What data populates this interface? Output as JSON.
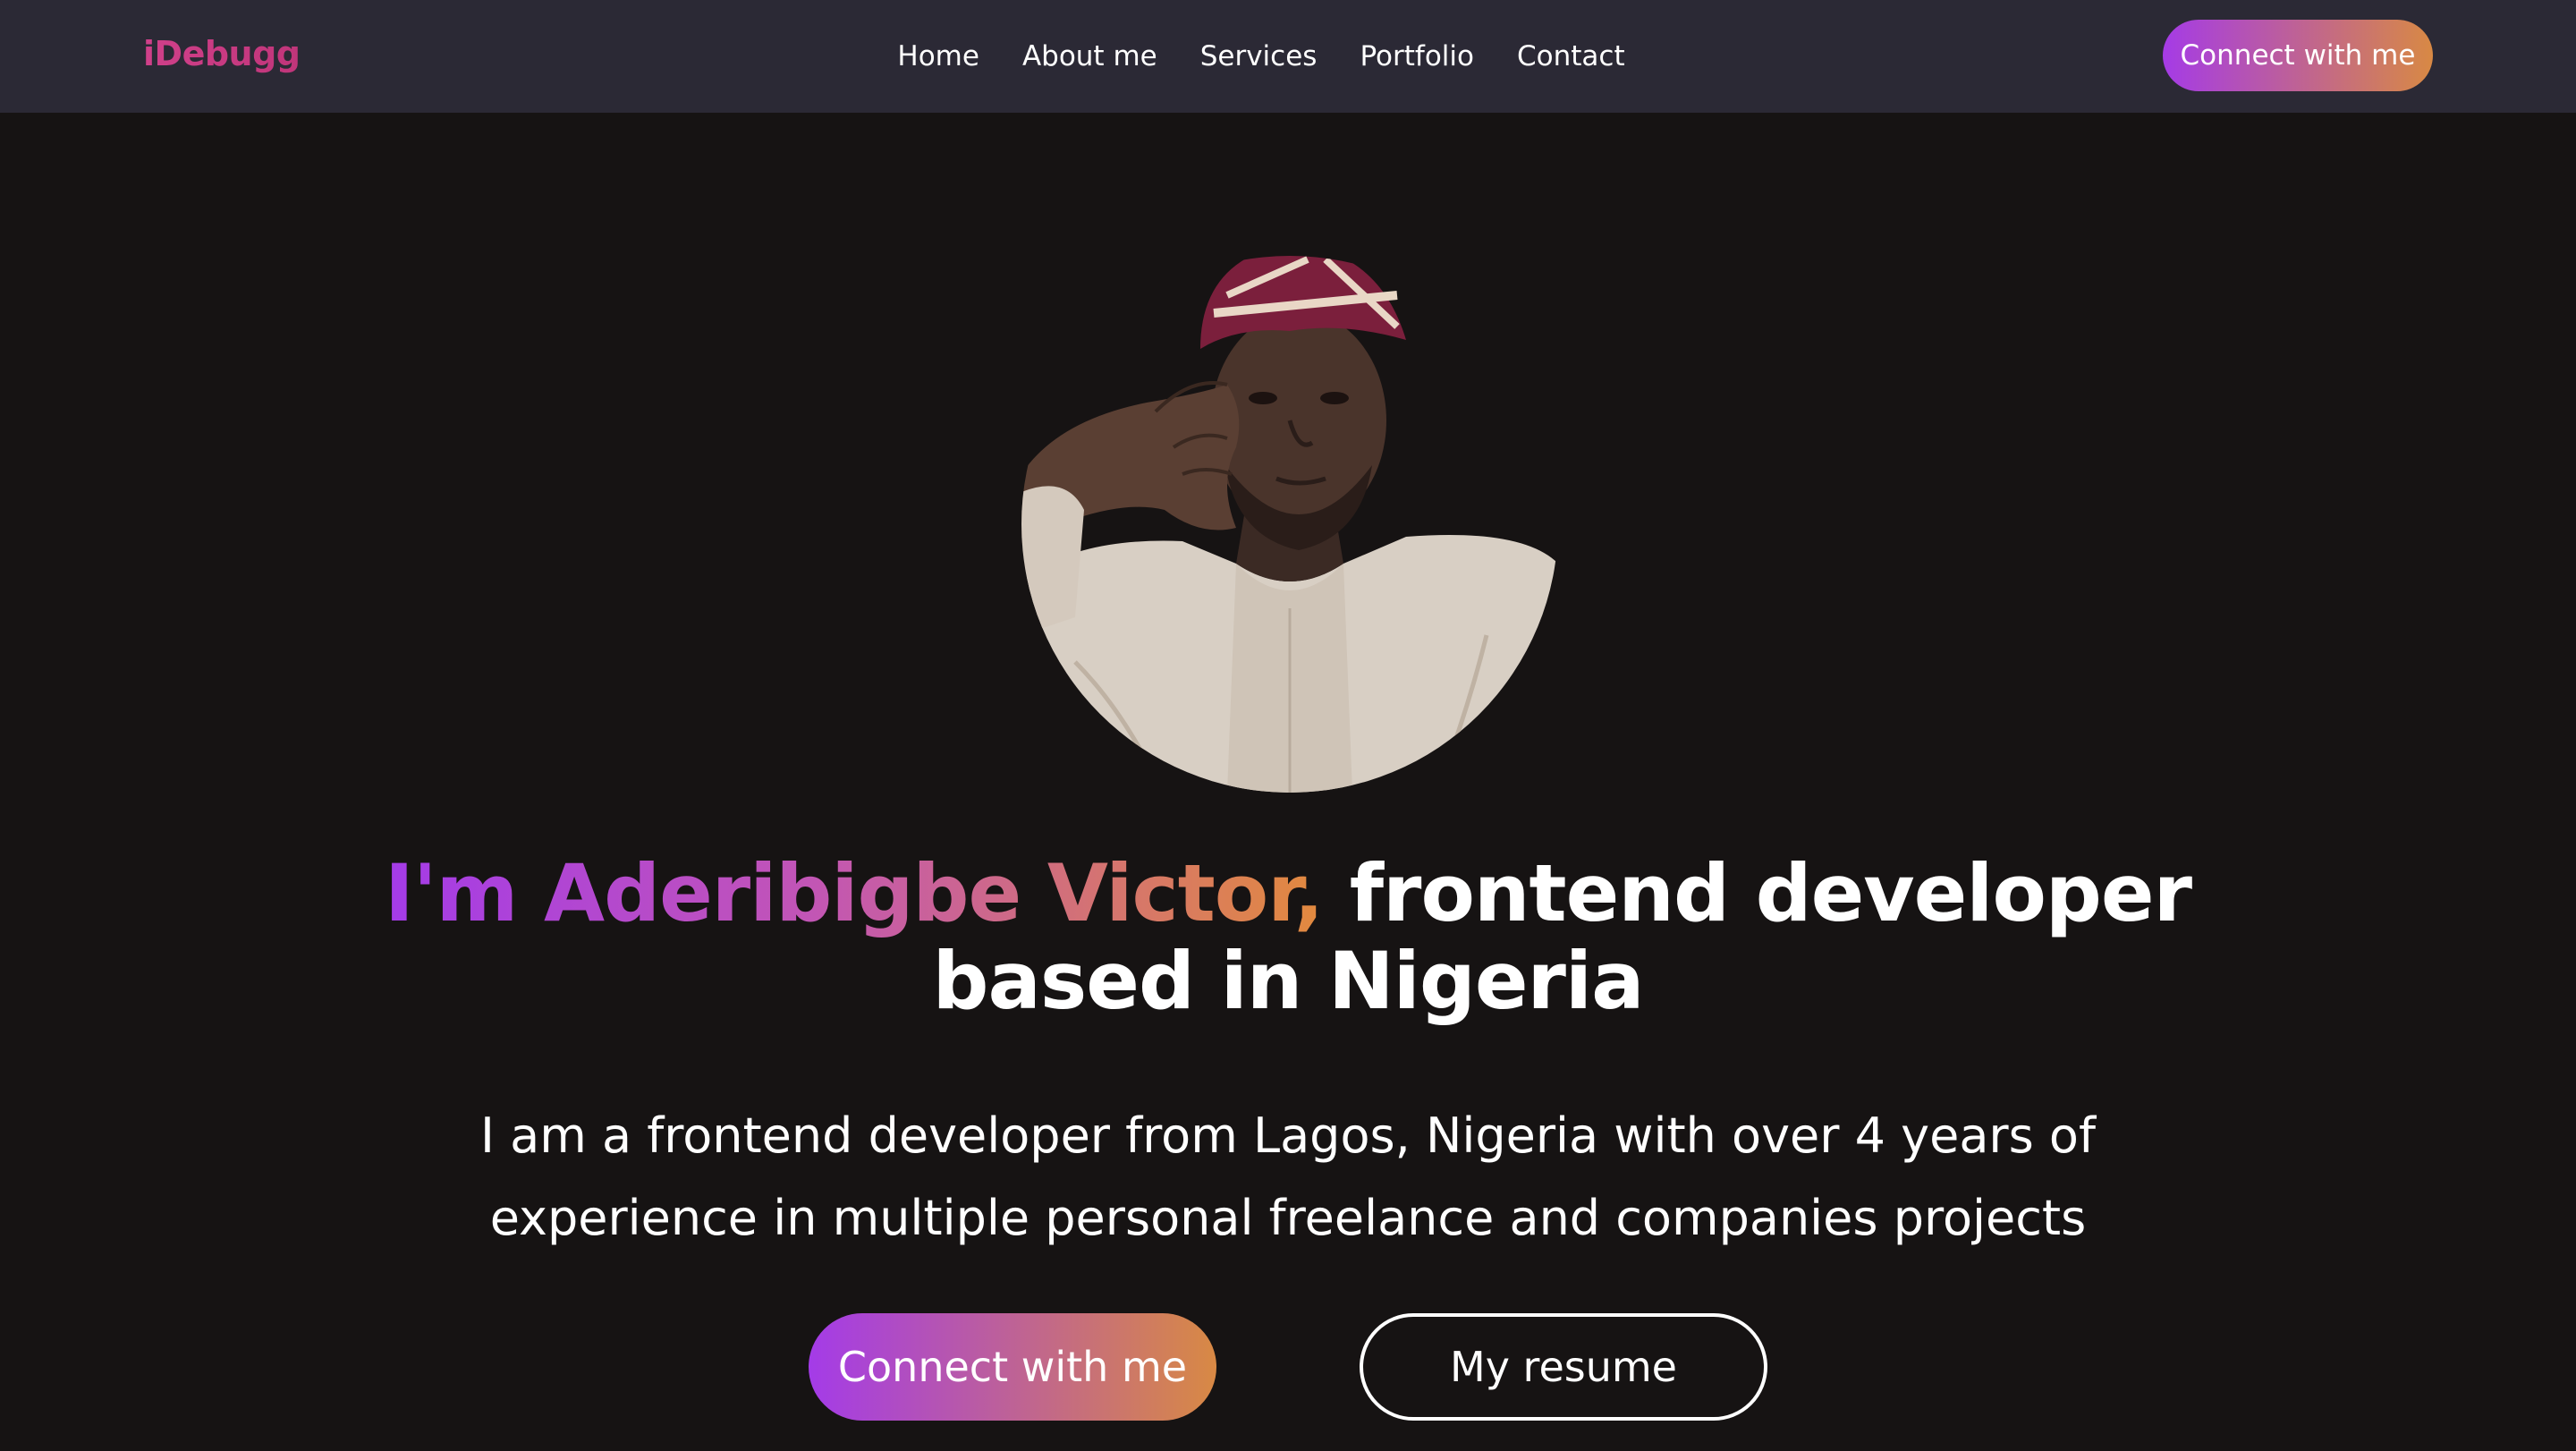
{
  "navbar": {
    "brand": "iDebugg",
    "links": [
      "Home",
      "About me",
      "Services",
      "Portfolio",
      "Contact"
    ],
    "cta_label": "Connect with me"
  },
  "hero": {
    "photo_alt": "Portrait photo",
    "title_highlight": "I'm Aderibigbe Victor,",
    "title_rest": " frontend developer based in Nigeria",
    "subtitle": "I am a frontend developer from Lagos, Nigeria with over 4 years of experience in multiple personal freelance and companies projects",
    "primary_button": "Connect with me",
    "secondary_button": "My resume"
  },
  "colors": {
    "background": "#161313",
    "navbar": "#2b2935",
    "brand": "#d0408a",
    "gradient_start": "#a43be8",
    "gradient_end": "#d88944"
  }
}
